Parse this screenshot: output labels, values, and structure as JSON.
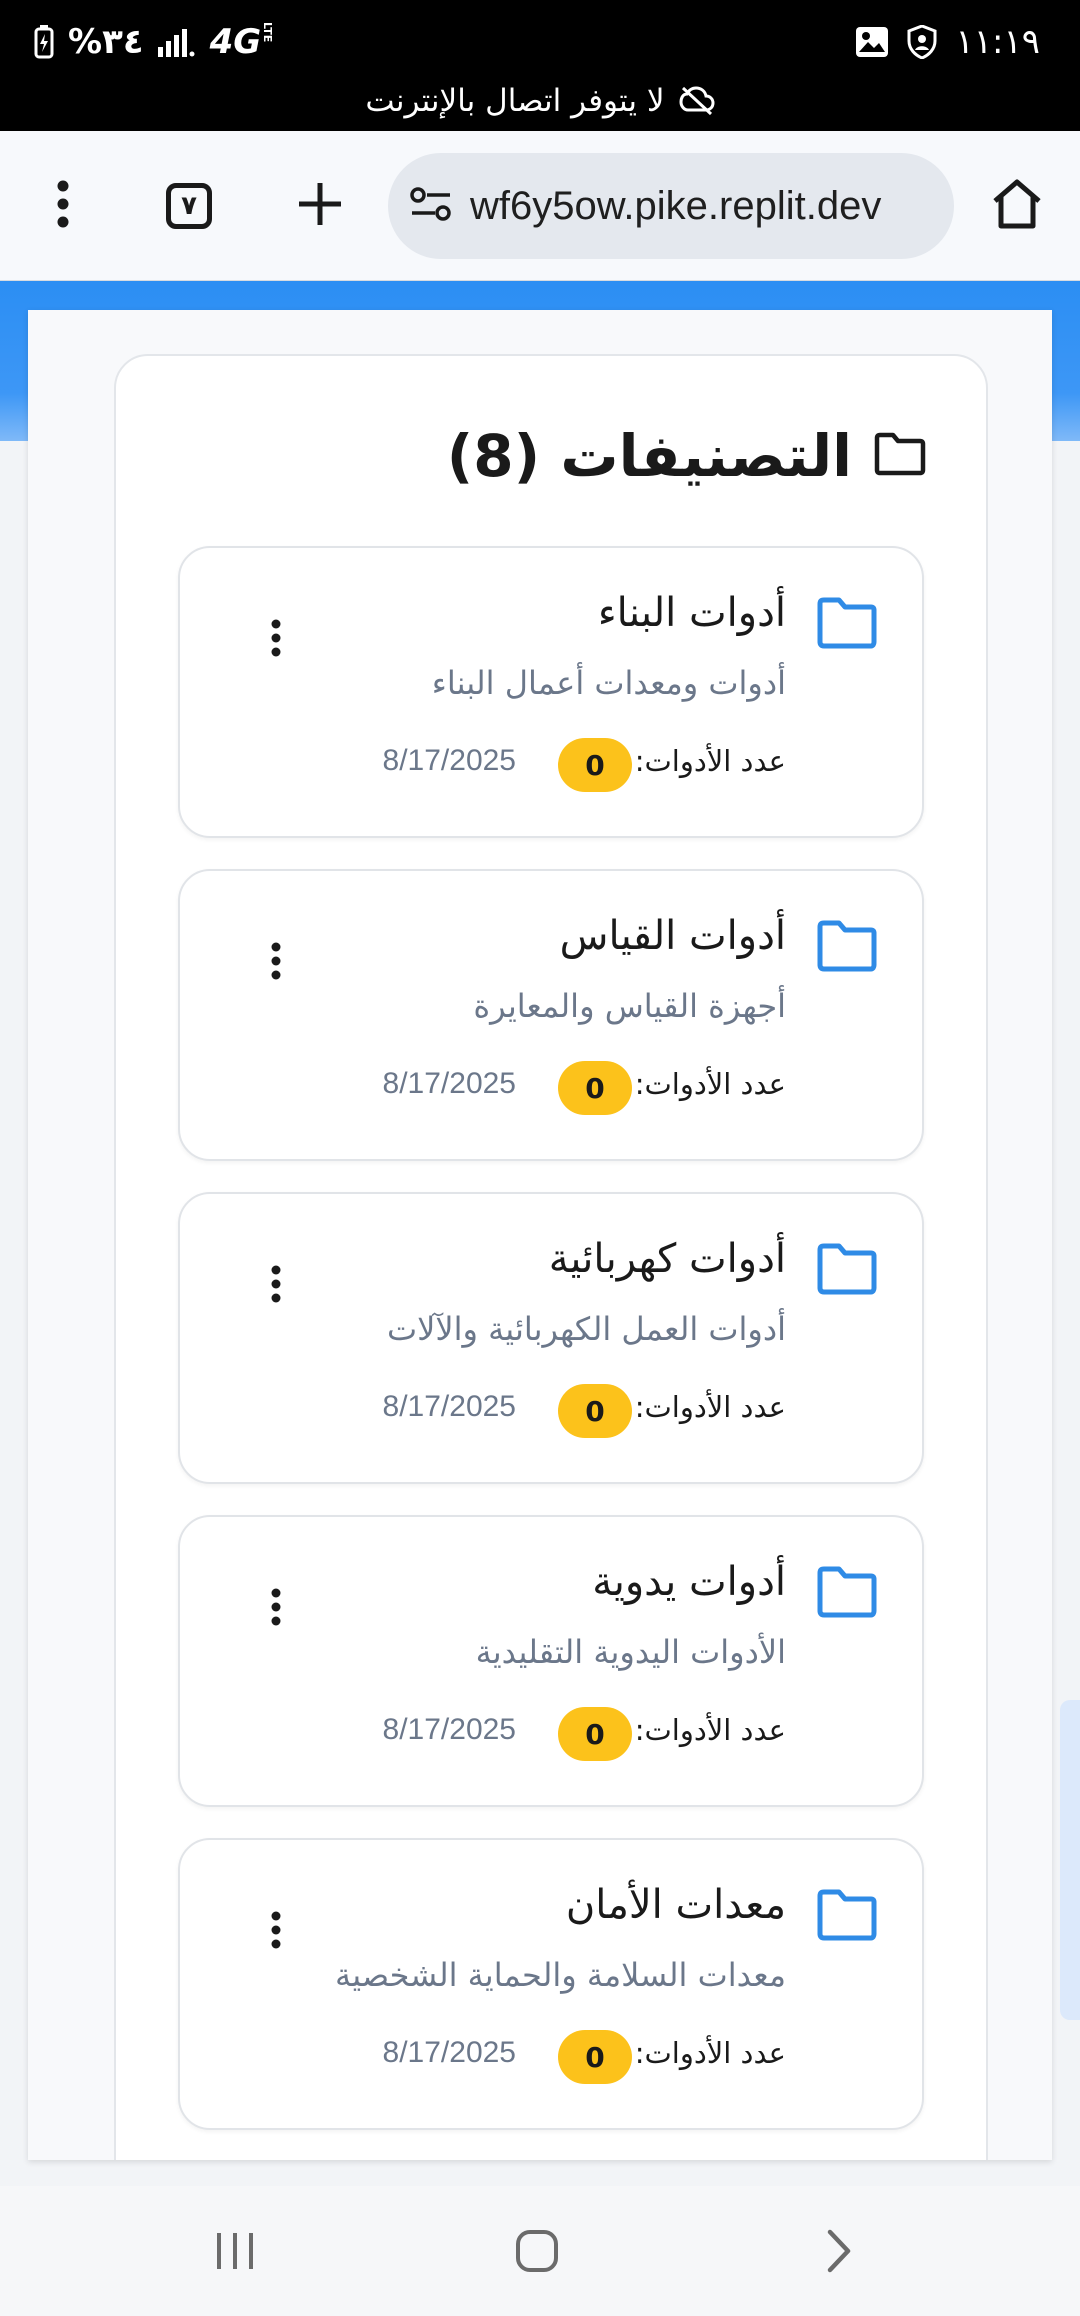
{
  "status_bar": {
    "battery": "%٣٤",
    "network": "4G",
    "network_sub": "LTE",
    "time": "١١:١٩",
    "offline_message": "لا يتوفر اتصال بالإنترنت"
  },
  "browser": {
    "url": "wf6y5ow.pike.replit.dev",
    "tab_count": "٧"
  },
  "panel": {
    "title": "التصنيفات (8)"
  },
  "categories": [
    {
      "name": "أدوات البناء",
      "description": "أدوات ومعدات أعمال البناء",
      "count_label": "عدد الأدوات:",
      "count": "0",
      "date": "8/17/2025"
    },
    {
      "name": "أدوات القياس",
      "description": "أجهزة القياس والمعايرة",
      "count_label": "عدد الأدوات:",
      "count": "0",
      "date": "8/17/2025"
    },
    {
      "name": "أدوات كهربائية",
      "description": "أدوات العمل الكهربائية والآلات",
      "count_label": "عدد الأدوات:",
      "count": "0",
      "date": "8/17/2025"
    },
    {
      "name": "أدوات يدوية",
      "description": "الأدوات اليدوية التقليدية",
      "count_label": "عدد الأدوات:",
      "count": "0",
      "date": "8/17/2025"
    },
    {
      "name": "معدات الأمان",
      "description": "معدات السلامة والحماية الشخصية",
      "count_label": "عدد الأدوات:",
      "count": "0",
      "date": "8/17/2025"
    }
  ],
  "colors": {
    "accent_blue": "#2b8ef3",
    "folder_blue": "#2f8be6",
    "badge_yellow": "#fcc21b",
    "muted_text": "#6b778a"
  },
  "icons": {
    "browser": [
      "more-vert-icon",
      "tabs-icon",
      "plus-icon",
      "site-settings-icon",
      "home-icon"
    ],
    "category": [
      "folder-icon",
      "more-vert-icon"
    ],
    "nav": [
      "recents-icon",
      "home-circle-icon",
      "back-icon"
    ]
  }
}
